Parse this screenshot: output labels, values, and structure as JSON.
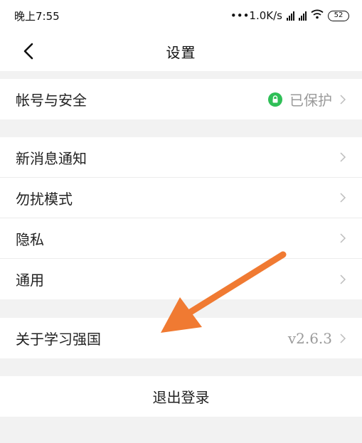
{
  "status_bar": {
    "time": "晚上7:55",
    "network_speed": "•••1.0K/s",
    "battery": "52"
  },
  "header": {
    "back_icon": "chevron-left-icon",
    "title": "设置"
  },
  "sections": {
    "account": {
      "label": "帐号与安全",
      "status": "已保护",
      "status_icon": "lock-icon",
      "status_color": "#2fbf57"
    },
    "general": [
      {
        "label": "新消息通知"
      },
      {
        "label": "勿扰模式"
      },
      {
        "label": "隐私"
      },
      {
        "label": "通用"
      }
    ],
    "about": {
      "label": "关于学习强国",
      "version": "v2.6.3"
    }
  },
  "logout_label": "退出登录",
  "annotation": {
    "arrow_color": "#f07a32"
  }
}
